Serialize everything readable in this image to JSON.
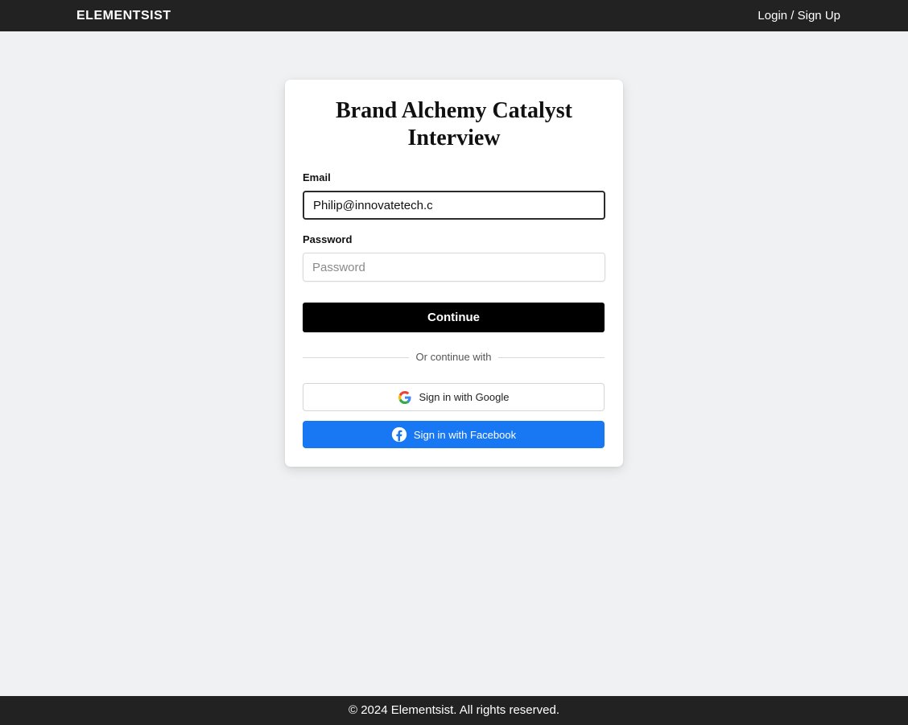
{
  "header": {
    "logo_text": "ELEMENTSIST",
    "nav_login": "Login / Sign Up"
  },
  "card": {
    "title": "Brand Alchemy Catalyst Interview",
    "email_label": "Email",
    "email_value": "Philip@innovatetech.c",
    "password_label": "Password",
    "password_placeholder": "Password",
    "continue_label": "Continue",
    "divider_text": "Or continue with",
    "google_label": "Sign in with Google",
    "google_icon": "google-icon",
    "facebook_label": "Sign in with Facebook",
    "facebook_icon": "facebook-icon"
  },
  "footer": {
    "copyright": "© 2024 Elementsist. All rights reserved."
  },
  "colors": {
    "header_bg": "#222222",
    "page_bg": "#f0f1f3",
    "primary_button": "#000000",
    "facebook_blue": "#1877f2"
  }
}
